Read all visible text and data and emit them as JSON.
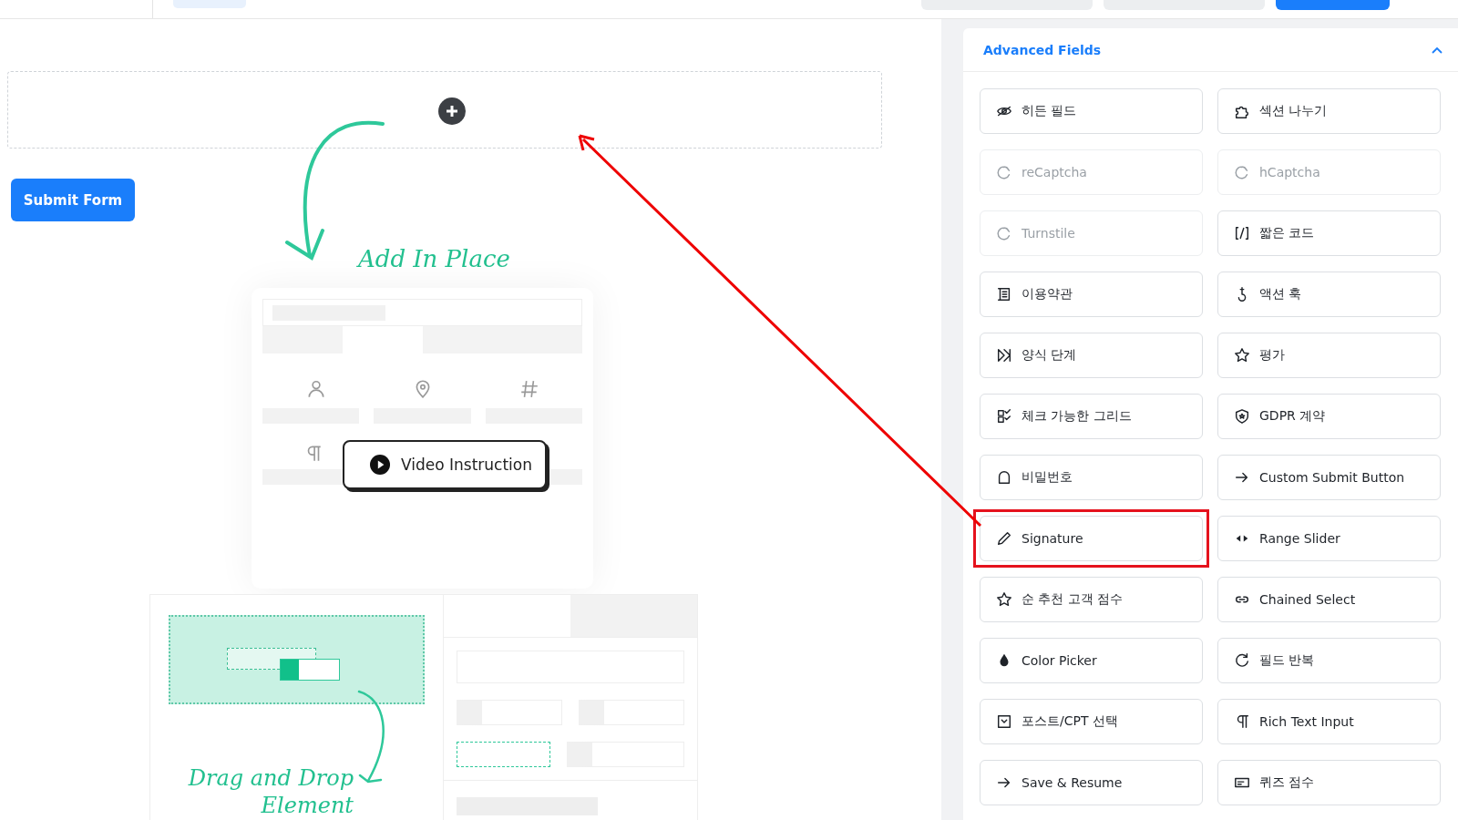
{
  "canvas": {
    "submit_button": "Submit Form",
    "add_label": "Add In Place",
    "video_button": "Video Instruction",
    "drag_label": "Drag and Drop Element"
  },
  "panel": {
    "title": "Advanced Fields",
    "expanded": true,
    "fields": [
      {
        "label": "히든 필드",
        "disabled": false,
        "highlighted": false
      },
      {
        "label": "섹션 나누기",
        "disabled": false,
        "highlighted": false
      },
      {
        "label": "reCaptcha",
        "disabled": true,
        "highlighted": false
      },
      {
        "label": "hCaptcha",
        "disabled": true,
        "highlighted": false
      },
      {
        "label": "Turnstile",
        "disabled": true,
        "highlighted": false
      },
      {
        "label": "짧은 코드",
        "disabled": false,
        "highlighted": false
      },
      {
        "label": "이용약관",
        "disabled": false,
        "highlighted": false
      },
      {
        "label": "액션 훅",
        "disabled": false,
        "highlighted": false
      },
      {
        "label": "양식 단계",
        "disabled": false,
        "highlighted": false
      },
      {
        "label": "평가",
        "disabled": false,
        "highlighted": false
      },
      {
        "label": "체크 가능한 그리드",
        "disabled": false,
        "highlighted": false
      },
      {
        "label": "GDPR 계약",
        "disabled": false,
        "highlighted": false
      },
      {
        "label": "비밀번호",
        "disabled": false,
        "highlighted": false
      },
      {
        "label": "Custom Submit Button",
        "disabled": false,
        "highlighted": false
      },
      {
        "label": "Signature",
        "disabled": false,
        "highlighted": true
      },
      {
        "label": "Range Slider",
        "disabled": false,
        "highlighted": false
      },
      {
        "label": "순 추천 고객 점수",
        "disabled": false,
        "highlighted": false
      },
      {
        "label": "Chained Select",
        "disabled": false,
        "highlighted": false
      },
      {
        "label": "Color Picker",
        "disabled": false,
        "highlighted": false
      },
      {
        "label": "필드 반복",
        "disabled": false,
        "highlighted": false
      },
      {
        "label": "포스트/CPT 선택",
        "disabled": false,
        "highlighted": false
      },
      {
        "label": "Rich Text Input",
        "disabled": false,
        "highlighted": false
      },
      {
        "label": "Save & Resume",
        "disabled": false,
        "highlighted": false
      },
      {
        "label": "퀴즈 점수",
        "disabled": false,
        "highlighted": false
      }
    ]
  }
}
